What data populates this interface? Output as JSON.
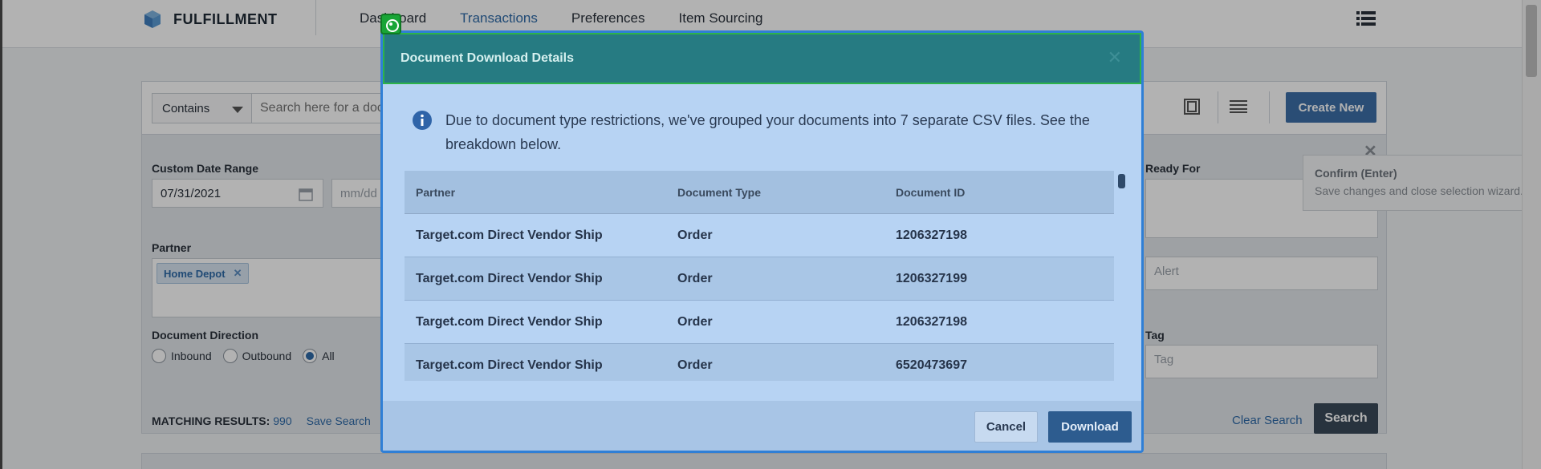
{
  "app": {
    "name": "FULFILLMENT",
    "nav": [
      "Dashboard",
      "Transactions",
      "Preferences",
      "Item Sourcing"
    ],
    "active_nav": "Transactions"
  },
  "search": {
    "operator": "Contains",
    "placeholder": "Search here for a doc",
    "create_label": "Create New"
  },
  "filters": {
    "date_label": "Custom Date Range",
    "date_from": "07/31/2021",
    "date_to_placeholder": "mm/dd",
    "partner_label": "Partner",
    "partner_chip": "Home Depot",
    "direction_label": "Document Direction",
    "directions": [
      "Inbound",
      "Outbound",
      "All"
    ],
    "direction_selected": "All",
    "ready_label": "Ready For",
    "alert_placeholder": "Alert",
    "tag_label": "Tag",
    "tag_placeholder": "Tag"
  },
  "results": {
    "label": "MATCHING RESULTS:",
    "count": "990",
    "save_label": "Save Search",
    "clear_label": "Clear Search",
    "search_label": "Search"
  },
  "tooltip": {
    "title": "Confirm (Enter)",
    "body": "Save changes and close selection wizard."
  },
  "modal": {
    "title": "Document Download Details",
    "info": "Due to document type restrictions, we've grouped your documents into 7 separate CSV files. See the breakdown below.",
    "columns": [
      "Partner",
      "Document Type",
      "Document ID"
    ],
    "rows": [
      [
        "Target.com Direct Vendor Ship",
        "Order",
        "1206327198"
      ],
      [
        "Target.com Direct Vendor Ship",
        "Order",
        "1206327199"
      ],
      [
        "Target.com Direct Vendor Ship",
        "Order",
        "1206327198"
      ],
      [
        "Target.com Direct Vendor Ship",
        "Order",
        "6520473697"
      ]
    ],
    "cancel_label": "Cancel",
    "download_label": "Download"
  },
  "colors": {
    "modal_header": "#267b82",
    "modal_body": "#b7d3f3",
    "primary": "#2d5c8f"
  }
}
